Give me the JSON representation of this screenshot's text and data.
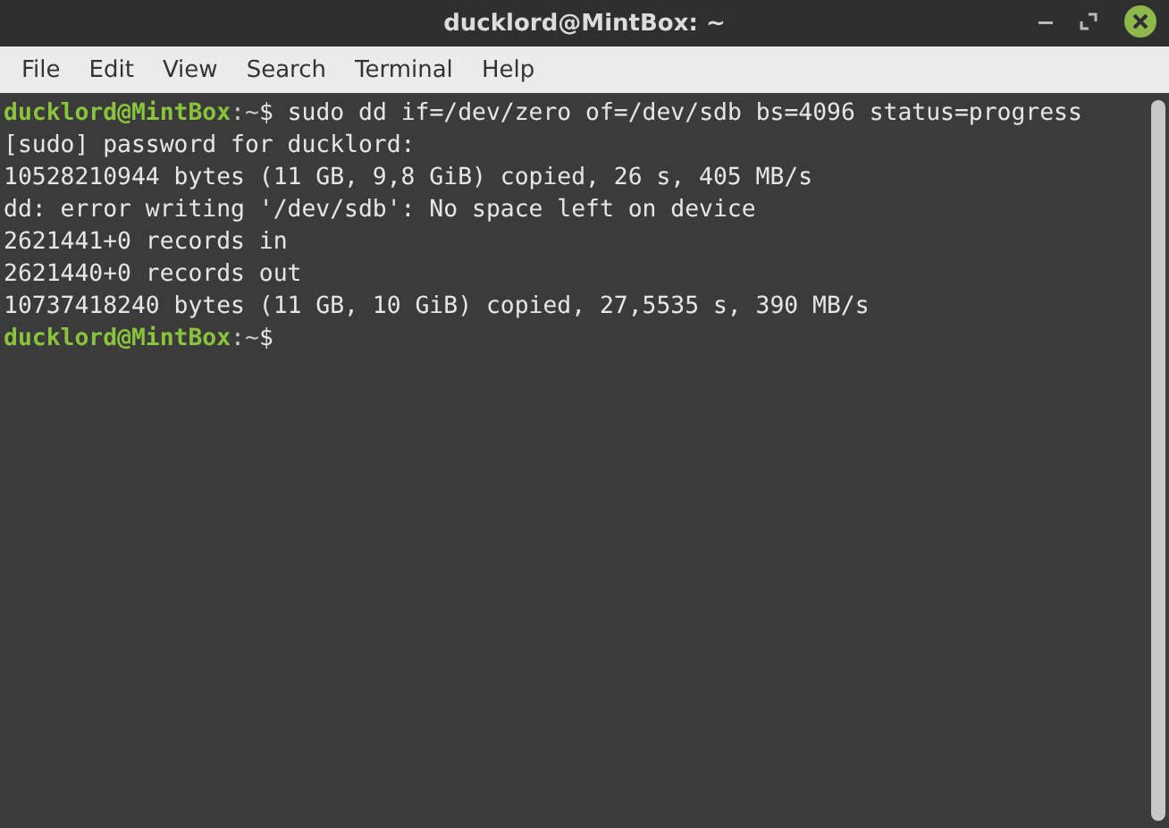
{
  "window": {
    "title": "ducklord@MintBox: ~"
  },
  "menu": [
    "File",
    "Edit",
    "View",
    "Search",
    "Terminal",
    "Help"
  ],
  "lines": [
    {
      "kind": "prompt",
      "user_host": "ducklord@MintBox",
      "path": ":~",
      "symbol": "$",
      "command": " sudo dd if=/dev/zero of=/dev/sdb bs=4096 status=progress"
    },
    {
      "kind": "output",
      "text": "[sudo] password for ducklord:"
    },
    {
      "kind": "output",
      "text": "10528210944 bytes (11 GB, 9,8 GiB) copied, 26 s, 405 MB/s"
    },
    {
      "kind": "output",
      "text": "dd: error writing '/dev/sdb': No space left on device"
    },
    {
      "kind": "output",
      "text": "2621441+0 records in"
    },
    {
      "kind": "output",
      "text": "2621440+0 records out"
    },
    {
      "kind": "output",
      "text": "10737418240 bytes (11 GB, 10 GiB) copied, 27,5535 s, 390 MB/s"
    },
    {
      "kind": "prompt",
      "user_host": "ducklord@MintBox",
      "path": ":~",
      "symbol": "$"
    }
  ]
}
